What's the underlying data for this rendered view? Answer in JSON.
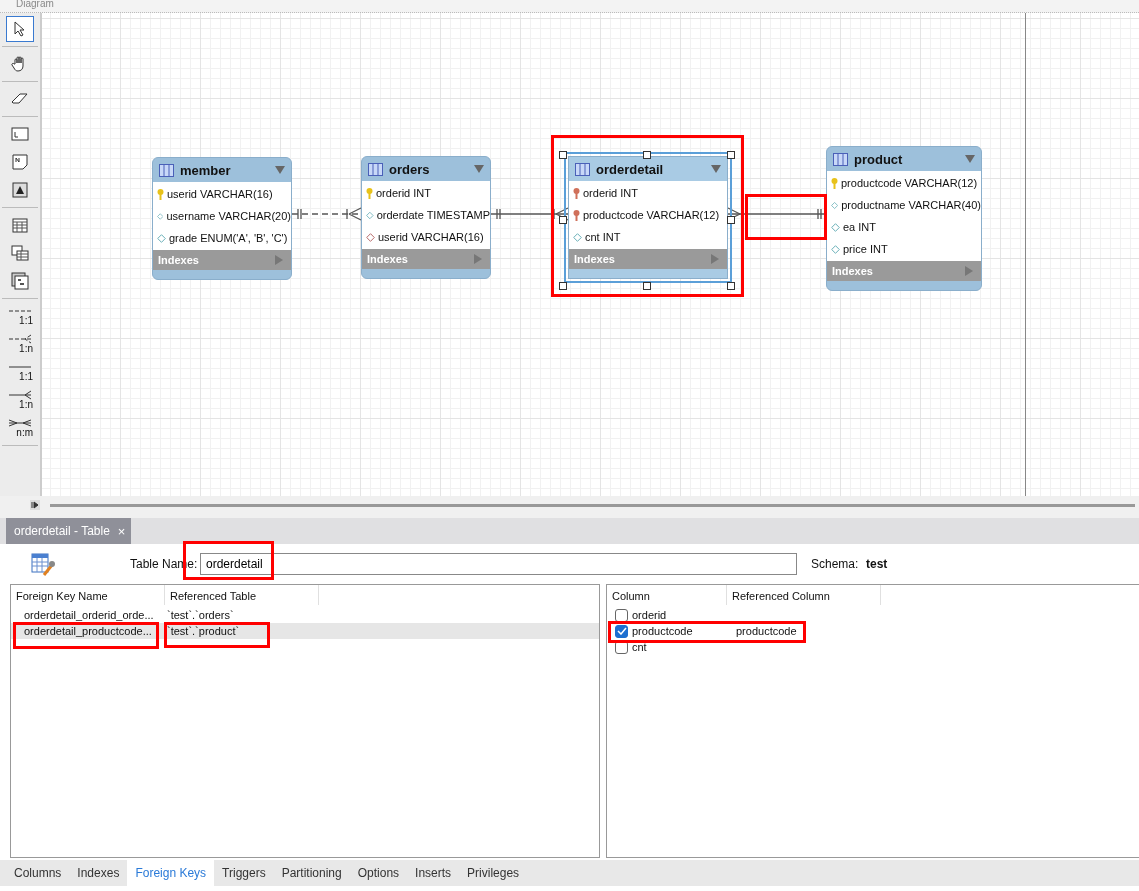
{
  "diagram": {
    "title": "Diagram",
    "toolbar": [
      {
        "kind": "pointer",
        "selected": true
      },
      {
        "kind": "hand",
        "selected": false
      },
      {
        "kind": "eraser",
        "selected": false
      },
      {
        "kind": "layer",
        "selected": false
      },
      {
        "kind": "note",
        "selected": false
      },
      {
        "kind": "image",
        "selected": false
      },
      {
        "kind": "table",
        "selected": false
      },
      {
        "kind": "view",
        "selected": false
      },
      {
        "kind": "routine",
        "selected": false
      },
      {
        "kind": "rel_dashed_one",
        "label": "1:1",
        "selected": false
      },
      {
        "kind": "rel_dashed_many",
        "label": "1:n",
        "selected": false
      },
      {
        "kind": "rel_solid_one",
        "label": "1:1",
        "selected": false
      },
      {
        "kind": "rel_solid_many",
        "label": "1:n",
        "selected": false
      },
      {
        "kind": "rel_many_many",
        "label": "n:m",
        "selected": false
      }
    ],
    "entities": [
      {
        "name": "member",
        "selected": false,
        "indexes": "Indexes",
        "columns": [
          {
            "kind": "pk",
            "text": "userid VARCHAR(16)"
          },
          {
            "kind": "column",
            "text": "username VARCHAR(20)"
          },
          {
            "kind": "column",
            "text": "grade ENUM('A', 'B', 'C')"
          }
        ]
      },
      {
        "name": "orders",
        "selected": false,
        "indexes": "Indexes",
        "columns": [
          {
            "kind": "pk",
            "text": "orderid INT"
          },
          {
            "kind": "column",
            "text": "orderdate TIMESTAMP"
          },
          {
            "kind": "fk",
            "text": "userid VARCHAR(16)"
          }
        ]
      },
      {
        "name": "orderdetail",
        "selected": true,
        "indexes": "Indexes",
        "columns": [
          {
            "kind": "pk_fk",
            "text": "orderid INT"
          },
          {
            "kind": "pk_fk",
            "text": "productcode VARCHAR(12)"
          },
          {
            "kind": "column",
            "text": "cnt INT"
          }
        ]
      },
      {
        "name": "product",
        "selected": false,
        "indexes": "Indexes",
        "columns": [
          {
            "kind": "pk",
            "text": "productcode VARCHAR(12)"
          },
          {
            "kind": "column",
            "text": "productname VARCHAR(40)"
          },
          {
            "kind": "column",
            "text": "ea INT"
          },
          {
            "kind": "column",
            "text": "price INT"
          }
        ]
      }
    ],
    "relationships": [
      {
        "kind": "non_identifying_parent_left"
      },
      {
        "kind": "identifying_parent_left"
      },
      {
        "kind": "identifying_parent_right"
      }
    ]
  },
  "editor": {
    "tab": {
      "label": "orderdetail - Table",
      "close": "×"
    },
    "table_name_label": "Table Name:",
    "table_name": "orderdetail",
    "schema_label": "Schema:",
    "schema": "test",
    "foreign_keys": {
      "columns": [
        "Foreign Key Name",
        "Referenced Table"
      ],
      "rows": [
        {
          "name": "orderdetail_orderid_orde...",
          "table": "`test`.`orders`",
          "selected": false
        },
        {
          "name": "orderdetail_productcode...",
          "table": "`test`.`product`",
          "selected": true
        }
      ]
    },
    "fk_columns": {
      "columns": [
        "Column",
        "Referenced Column"
      ],
      "rows": [
        {
          "column": "orderid",
          "checked": false
        },
        {
          "column": "productcode",
          "checked": true,
          "referenced": "productcode"
        },
        {
          "column": "cnt",
          "checked": false
        }
      ]
    },
    "bottom_tabs": [
      {
        "label": "Columns",
        "selected": false
      },
      {
        "label": "Indexes",
        "selected": false
      },
      {
        "label": "Foreign Keys",
        "selected": true
      },
      {
        "label": "Triggers",
        "selected": false
      },
      {
        "label": "Partitioning",
        "selected": false
      },
      {
        "label": "Options",
        "selected": false
      },
      {
        "label": "Inserts",
        "selected": false
      },
      {
        "label": "Privileges",
        "selected": false
      }
    ]
  },
  "highlights": [
    {
      "kind": "box"
    },
    {
      "kind": "box"
    },
    {
      "kind": "box"
    },
    {
      "kind": "box"
    },
    {
      "kind": "box"
    },
    {
      "kind": "box"
    }
  ]
}
